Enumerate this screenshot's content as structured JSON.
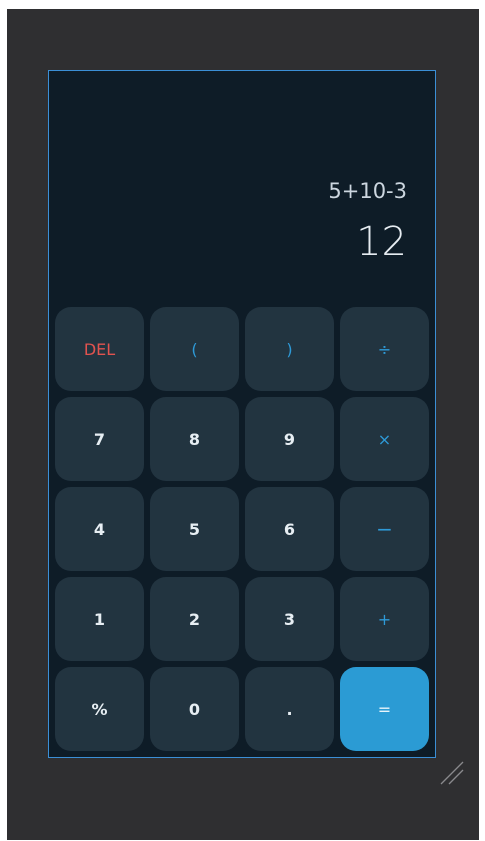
{
  "display": {
    "expression": "5+10-3",
    "result": "12"
  },
  "keys": {
    "del": "DEL",
    "lparen": "(",
    "rparen": ")",
    "divide": "÷",
    "seven": "7",
    "eight": "8",
    "nine": "9",
    "multiply": "×",
    "four": "4",
    "five": "5",
    "six": "6",
    "minus": "−",
    "one": "1",
    "two": "2",
    "three": "3",
    "plus": "+",
    "percent": "%",
    "zero": "0",
    "dot": ".",
    "equals": "="
  },
  "colors": {
    "background": "#2f2f31",
    "panel": "#0e1c27",
    "key": "#223440",
    "accent": "#2e9ad8",
    "danger": "#e2534f",
    "equals": "#2b9bd4"
  },
  "icons": {
    "resize": "resize-grip-icon"
  }
}
